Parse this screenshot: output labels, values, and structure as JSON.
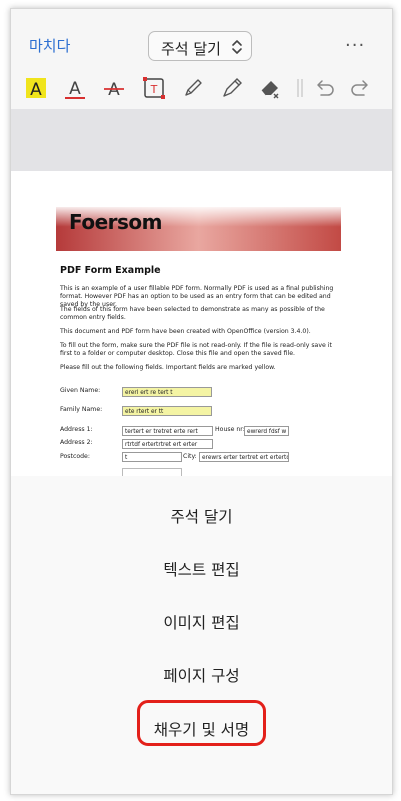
{
  "header": {
    "done_label": "마치다",
    "mode_label": "주석 달기",
    "more_label": "···"
  },
  "toolbar": {
    "tools": [
      {
        "name": "highlight-tool",
        "glyph": "A"
      },
      {
        "name": "text-color-tool",
        "glyph": "A"
      },
      {
        "name": "strikethrough-tool",
        "glyph": "A"
      },
      {
        "name": "text-box-tool",
        "glyph": "T"
      }
    ],
    "highlight_color": "#f0e41c",
    "underline_color": "#d83030",
    "strike_color": "#d83030",
    "accent": "#2d6fd1"
  },
  "document": {
    "banner_title": "Foersom",
    "heading": "PDF Form Example",
    "paragraphs": [
      "This is an example of a user fillable PDF form. Normally PDF is used as a final publishing format. However PDF has an option to be used as an entry form that can be edited and saved by the user.",
      "The fields of this form have been selected to demonstrate as many as possible of the common entry fields.",
      "This document and PDF form have been created with OpenOffice (version 3.4.0).",
      "To fill out the form, make sure the PDF file is not read-only. If the file is read-only save it first to a folder or computer desktop. Close this file and open the saved file.",
      "Please fill out the following fields. Important fields are marked yellow."
    ],
    "fields": {
      "given_name_label": "Given Name:",
      "given_name_value": "ererl ert re tert t",
      "family_name_label": "Family Name:",
      "family_name_value": "ete rtert er tt",
      "address1_label": "Address 1:",
      "address1_value": "tertert er tretret  erte rert",
      "house_label": "House nr:",
      "house_value": "ewrerd fdsf w",
      "address2_label": "Address 2:",
      "address2_value": "rtrtdf ertertrtret ert erter",
      "postcode_label": "Postcode:",
      "postcode_value": "t",
      "city_label": "City:",
      "city_value": "erewrs erter tertret ert ertertd f"
    }
  },
  "menu": {
    "items": [
      {
        "label": "주석 달기"
      },
      {
        "label": "텍스트 편집"
      },
      {
        "label": "이미지 편집"
      },
      {
        "label": "페이지 구성"
      },
      {
        "label": "채우기 및 서명"
      }
    ],
    "highlight_color": "#e3201a"
  }
}
